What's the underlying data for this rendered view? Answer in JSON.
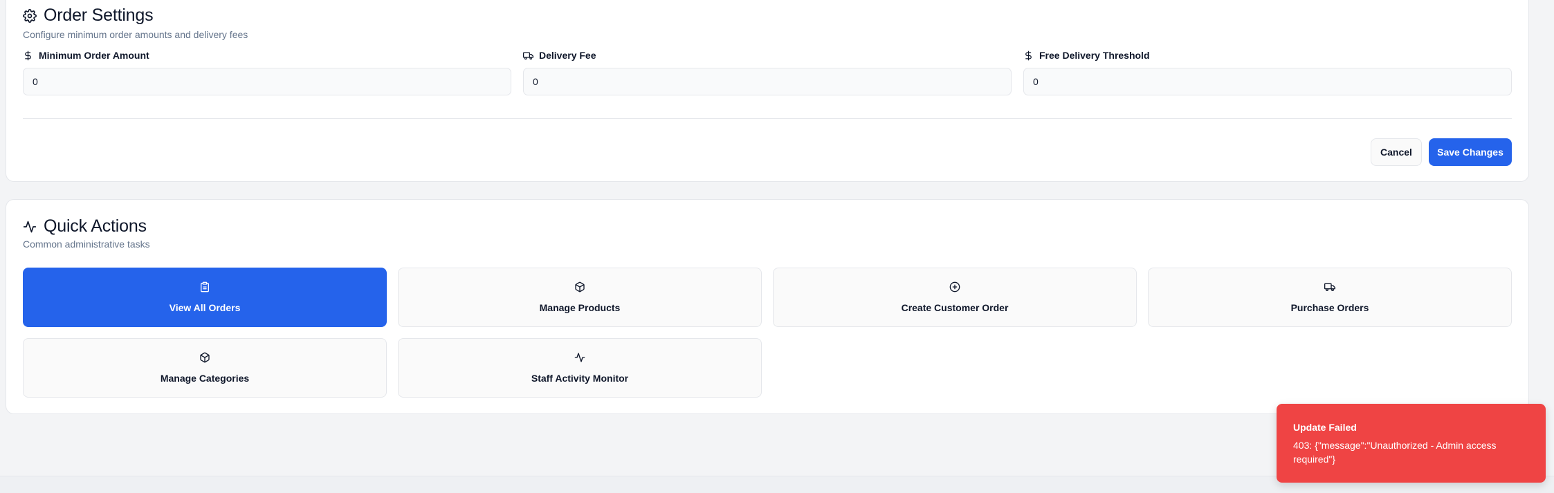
{
  "order_settings": {
    "title": "Order Settings",
    "subtitle": "Configure minimum order amounts and delivery fees",
    "title_icon": "gear-icon",
    "fields": [
      {
        "label": "Minimum Order Amount",
        "value": "0",
        "icon": "dollar-icon"
      },
      {
        "label": "Delivery Fee",
        "value": "0",
        "icon": "truck-icon"
      },
      {
        "label": "Free Delivery Threshold",
        "value": "0",
        "icon": "dollar-icon"
      }
    ],
    "cancel_label": "Cancel",
    "save_label": "Save Changes"
  },
  "quick_actions": {
    "title": "Quick Actions",
    "subtitle": "Common administrative tasks",
    "title_icon": "activity-icon",
    "items": [
      {
        "label": "View All Orders",
        "icon": "clipboard-icon"
      },
      {
        "label": "Manage Products",
        "icon": "package-icon"
      },
      {
        "label": "Create Customer Order",
        "icon": "plus-circle-icon"
      },
      {
        "label": "Purchase Orders",
        "icon": "truck-icon"
      },
      {
        "label": "Manage Categories",
        "icon": "package-icon"
      },
      {
        "label": "Staff Activity Monitor",
        "icon": "activity-icon"
      }
    ]
  },
  "toast": {
    "title": "Update Failed",
    "message": "403: {\"message\":\"Unauthorized - Admin access required\"}"
  },
  "colors": {
    "primary": "#2563eb",
    "error": "#ef4444",
    "muted_text": "#64748b"
  }
}
